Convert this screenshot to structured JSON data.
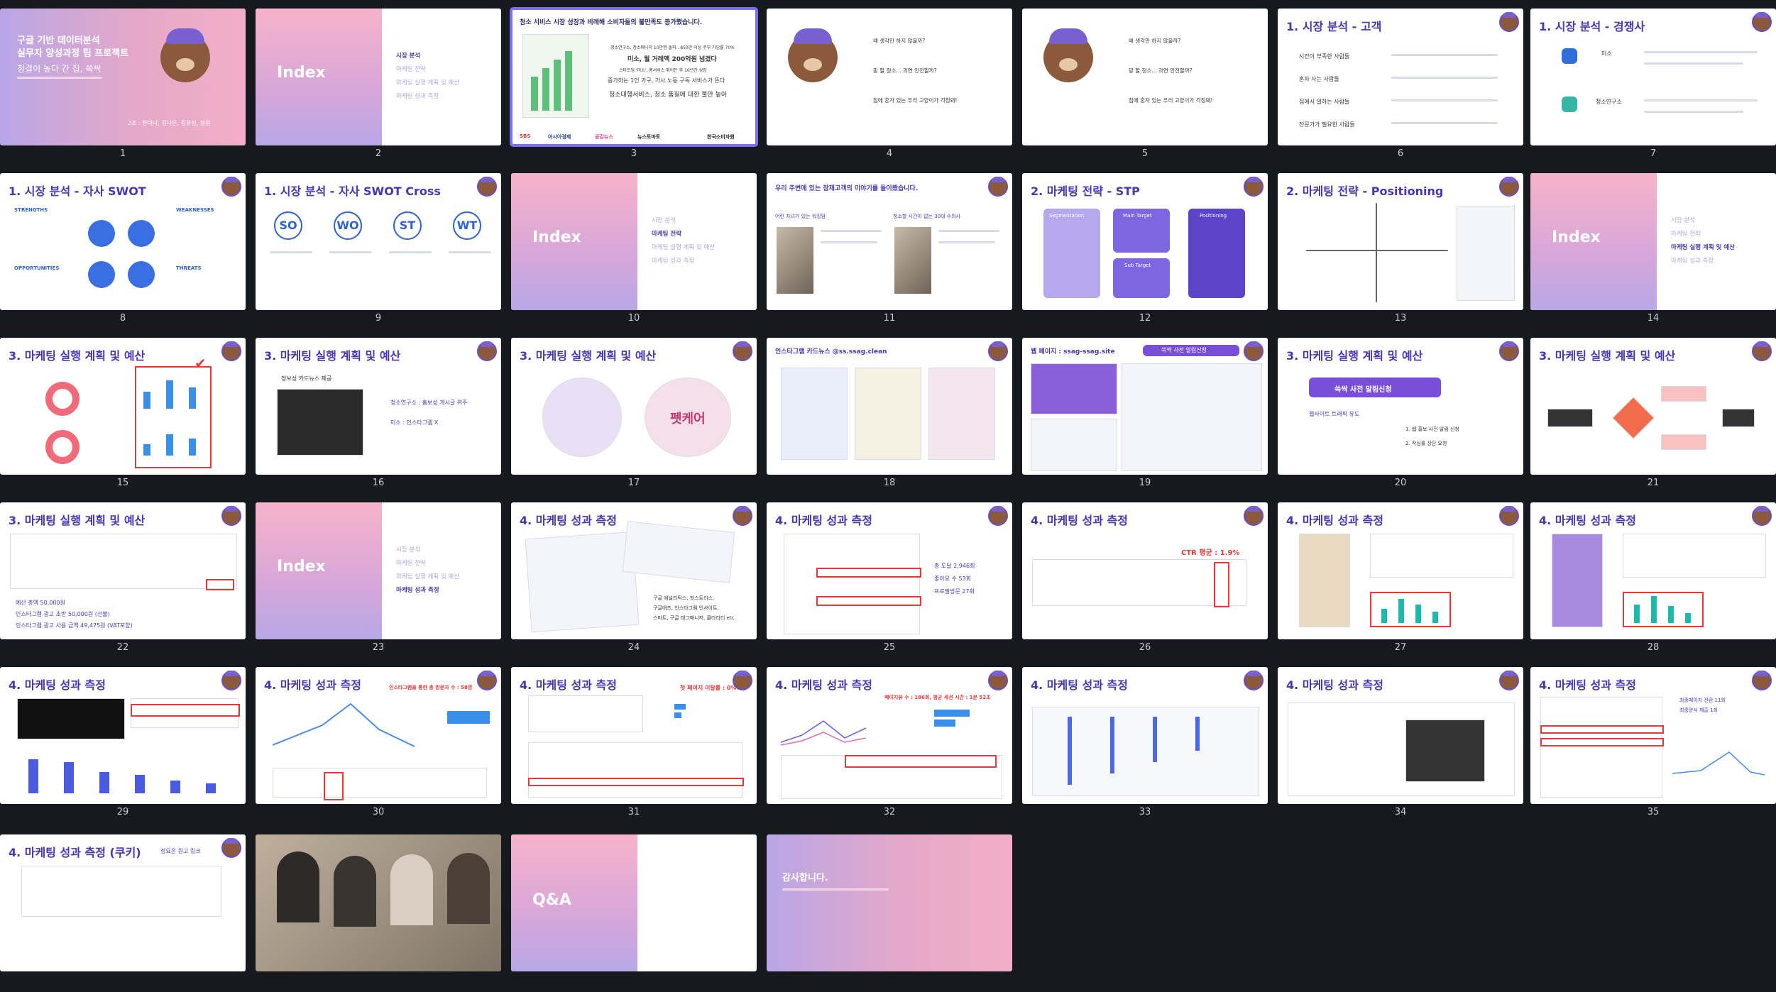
{
  "slides": [
    {
      "num": "1",
      "title_lines": [
        "구글 기반 데이터분석",
        "실무자 양성과정 팀 프로젝트"
      ],
      "subtitle": "청결이 높다 간 집, 쓱싹",
      "team": "2조 : 한아나, 김나은, 김유성, 정원"
    },
    {
      "num": "2",
      "title": "Index",
      "items": [
        "시장 분석",
        "마케팅 전략",
        "마케팅 실행 계획 및 예산",
        "마케팅 성과 측정"
      ],
      "active": 0
    },
    {
      "num": "3",
      "headline": "청소 서비스 시장 성장과 비례해 소비자들의 불만족도 증가했습니다.",
      "lines": [
        "청소연구소, 청소매니저 10만명 돌파.. 850만 이상 주부 가입률 70%",
        "미소, 월 거래액 200억원 넘겼다",
        "스타트업 '미소', 홈서비스 뛰어든 후 10년간 성장",
        "증가하는 1인 가구, 가사 노동 구독 서비스가 뜬다",
        "청소대행서비스, 청소 품질에 대한 불만 높아"
      ],
      "sources": [
        "SBS",
        "아시아경제",
        "공감뉴스",
        "뉴스토마토",
        "한국소비자원"
      ]
    },
    {
      "num": "4",
      "questions": [
        "왜 생각만 하지 않을까?",
        "믿 할 청소... 과연 안전할까?",
        "집에 혼자 있는 우리 고양이가 걱정돼!"
      ]
    },
    {
      "num": "5",
      "questions": [
        "왜 생각만 하지 않을까?",
        "믿 할 청소... 과연 안전할까?",
        "집에 혼자 있는 우리 고양이가 걱정돼!"
      ]
    },
    {
      "num": "6",
      "title": "1. 시장 분석 - 고객",
      "rows": [
        "시간이 부족한 사람들",
        "혼자 사는 사람들",
        "집에서 일하는 사람들",
        "전문가가 필요한 사람들"
      ]
    },
    {
      "num": "7",
      "title": "1. 시장 분석 - 경쟁사",
      "brands": [
        "미소",
        "청소연구소"
      ]
    },
    {
      "num": "8",
      "title": "1. 시장 분석 - 자사 SWOT",
      "labels": [
        "STRENGTHS",
        "WEAKNESSES",
        "OPPORTUNITIES",
        "THREATS"
      ]
    },
    {
      "num": "9",
      "title": "1. 시장 분석 - 자사 SWOT Cross",
      "labels": [
        "SO",
        "WO",
        "ST",
        "WT"
      ]
    },
    {
      "num": "10",
      "title": "Index",
      "items": [
        "시장 분석",
        "마케팅 전략",
        "마케팅 실행 계획 및 예산",
        "마케팅 성과 측정"
      ],
      "active": 1
    },
    {
      "num": "11",
      "title": "우리 주변에 있는 잠재고객의 이야기를 들어봤습니다.",
      "people": [
        "어린 자녀가 있는 워킹맘",
        "청소할 시간이 없는 30대 수의사"
      ]
    },
    {
      "num": "12",
      "title": "2. 마케팅 전략 - STP",
      "labels": [
        "Segmentation",
        "Main Target",
        "Positioning",
        "Sub Target"
      ]
    },
    {
      "num": "13",
      "title": "2. 마케팅 전략 - Positioning"
    },
    {
      "num": "14",
      "title": "Index",
      "items": [
        "시장 분석",
        "마케팅 전략",
        "마케팅 실행 계획 및 예산",
        "마케팅 성과 측정"
      ],
      "active": 2
    },
    {
      "num": "15",
      "title": "3. 마케팅 실행 계획 및 예산"
    },
    {
      "num": "16",
      "title": "3. 마케팅 실행 계획 및 예산",
      "lines": [
        "정보성 카드뉴스 제공",
        "청소연구소 : 홈보성 게시글 위주",
        "미소 : 인스타그램 X"
      ]
    },
    {
      "num": "17",
      "title": "3. 마케팅 실행 계획 및 예산",
      "word": "펫케어"
    },
    {
      "num": "18",
      "title": "인스타그램 카드뉴스 @ss.ssag.clean"
    },
    {
      "num": "19",
      "title": "웹 페이지 : ssag-ssag.site",
      "banner": "쓱싹 사전 알림신청"
    },
    {
      "num": "20",
      "title": "3. 마케팅 실행 계획 및 예산",
      "banner": "쓱싹 사전 알림신청",
      "lines": [
        "웹사이트 트래픽 유도",
        "1. 웹 홍보 사전 알림 신청",
        "2. 작심률 상단 요청"
      ]
    },
    {
      "num": "21",
      "title": "3. 마케팅 실행 계획 및 예산"
    },
    {
      "num": "22",
      "title": "3. 마케팅 실행 계획 및 예산",
      "lines": [
        "예산 총액 50,000원",
        "인스타그램 광고 초반 50,000원 (선불)",
        "인스타그램 광고 사용 금액 49,475원 (VAT포함)"
      ]
    },
    {
      "num": "23",
      "title": "Index",
      "items": [
        "시장 분석",
        "마케팅 전략",
        "마케팅 실행 계획 및 예산",
        "마케팅 성과 측정"
      ],
      "active": 3
    },
    {
      "num": "24",
      "title": "4. 마케팅 성과 측정",
      "lines": [
        "구글 애널리틱스, 핫스트리스,",
        "구글애즈, 인스타그램 인사이트,",
        "스마트, 구글 태그매니저, 클라리티 etc."
      ]
    },
    {
      "num": "25",
      "title": "4. 마케팅 성과 측정",
      "lines": [
        "총 도달 2,946회",
        "좋아요 수 53회",
        "프로필방문 27회"
      ]
    },
    {
      "num": "26",
      "title": "4. 마케팅 성과 측정",
      "note": "CTR 평균 : 1.9%"
    },
    {
      "num": "27",
      "title": "4. 마케팅 성과 측정"
    },
    {
      "num": "28",
      "title": "4. 마케팅 성과 측정"
    },
    {
      "num": "29",
      "title": "4. 마케팅 성과 측정"
    },
    {
      "num": "30",
      "title": "4. 마케팅 성과 측정",
      "note": "인스타그램을 통한 총 방문자 수 : 58명"
    },
    {
      "num": "31",
      "title": "4. 마케팅 성과 측정",
      "note": "첫 페이지 이탈률 : 0%"
    },
    {
      "num": "32",
      "title": "4. 마케팅 성과 측정",
      "note": "페이지뷰 수 : 186회, 평균 세션 시간 : 1분 52초"
    },
    {
      "num": "33",
      "title": "4. 마케팅 성과 측정"
    },
    {
      "num": "34",
      "title": "4. 마케팅 성과 측정"
    },
    {
      "num": "35",
      "title": "4. 마케팅 성과 측정",
      "lines": [
        "최종페이지 전환 11회",
        "최종양식 제출 1회"
      ]
    },
    {
      "num": "36",
      "title": "4. 마케팅 성과 측정 (쿠키)",
      "note": "정요은 원고 링크"
    },
    {
      "num": "37"
    },
    {
      "num": "38",
      "title": "Q&A"
    },
    {
      "num": "39",
      "title": "감사합니다."
    }
  ],
  "colors": {
    "accent": "#4736b3",
    "selection": "#7b6ef0",
    "background": "#16191d"
  }
}
